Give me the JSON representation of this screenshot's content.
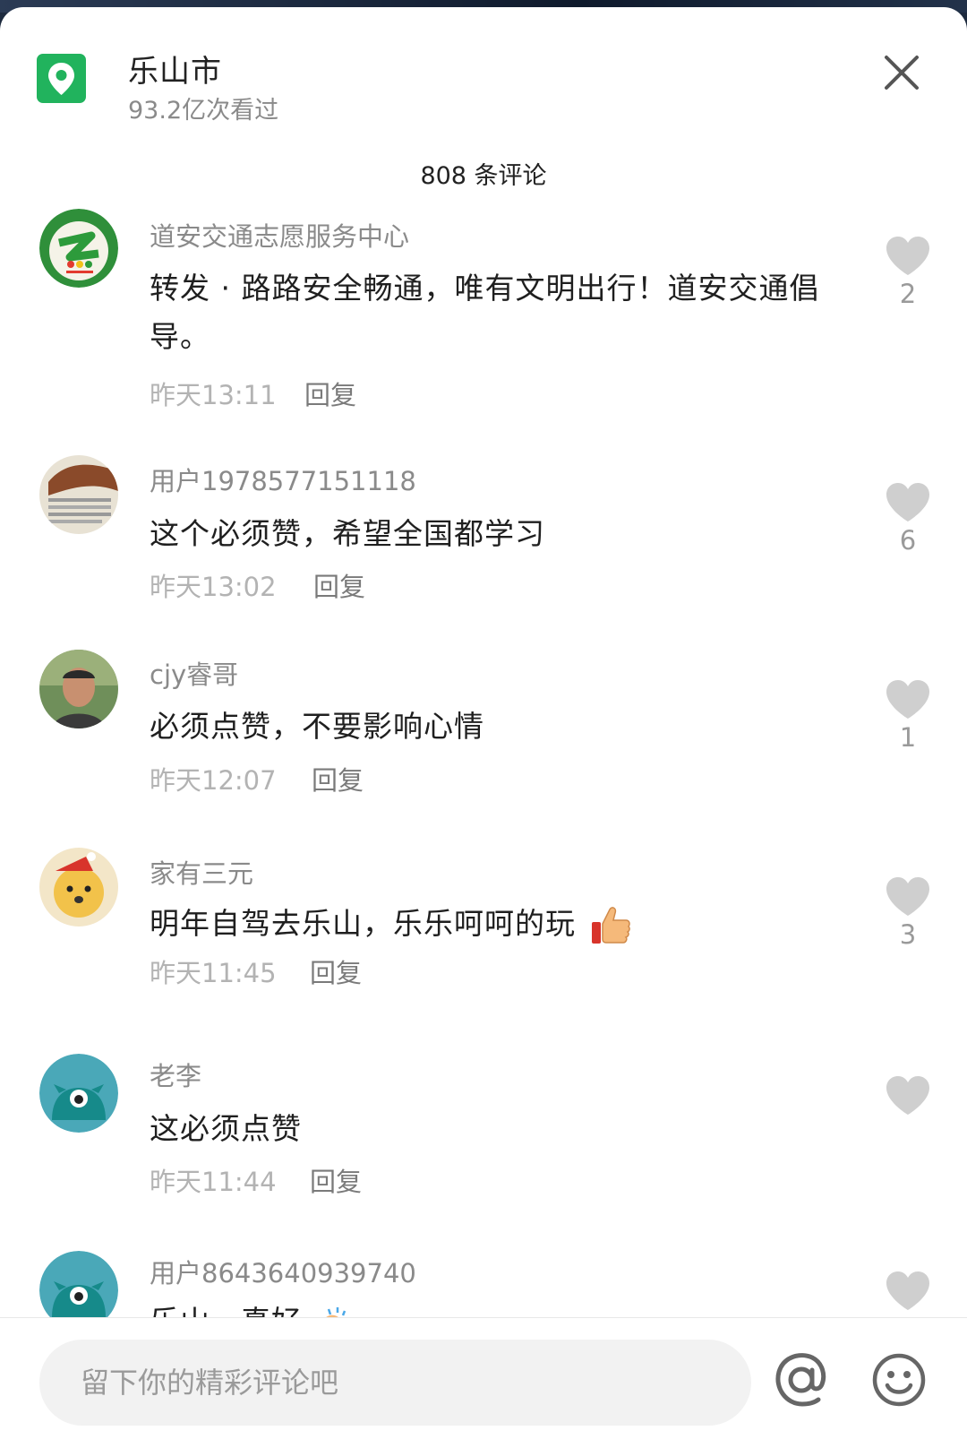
{
  "header": {
    "location_icon": "location-pin-icon",
    "title": "乐山市",
    "views": "93.2亿次看过",
    "close_icon": "close-icon"
  },
  "comments_title": "808 条评论",
  "comments": [
    {
      "username": "道安交通志愿服务中心",
      "text": "转发 · 路路安全畅通，唯有文明出行！道安交通倡导。",
      "time": "昨天13:11",
      "reply": "回复",
      "likes": "2"
    },
    {
      "username": "用户1978577151118",
      "text": "这个必须赞，希望全国都学习",
      "time": "昨天13:02",
      "reply": "回复",
      "likes": "6"
    },
    {
      "username": "cjy睿哥",
      "text": "必须点赞，不要影响心情",
      "time": "昨天12:07",
      "reply": "回复",
      "likes": "1"
    },
    {
      "username": "家有三元",
      "text": "明年自驾去乐山，乐乐呵呵的玩",
      "emoji": "thumbs-up-icon",
      "time": "昨天11:45",
      "reply": "回复",
      "likes": "3"
    },
    {
      "username": "老李",
      "text": "这必须点赞",
      "time": "昨天11:44",
      "reply": "回复",
      "likes": ""
    },
    {
      "username": "用户8643640939740",
      "text": "乐山，真好",
      "emoji": "clapping-hands-icon",
      "likes": ""
    }
  ],
  "input": {
    "placeholder": "留下你的精彩评论吧",
    "value": ""
  },
  "icons": {
    "heart": "heart-icon",
    "at": "at-mention-icon",
    "emoji": "emoji-smile-icon"
  },
  "colors": {
    "accent_green": "#21b35d",
    "heart_gray": "#cfcfcf",
    "avatar_teal": "#4aa8b8"
  }
}
